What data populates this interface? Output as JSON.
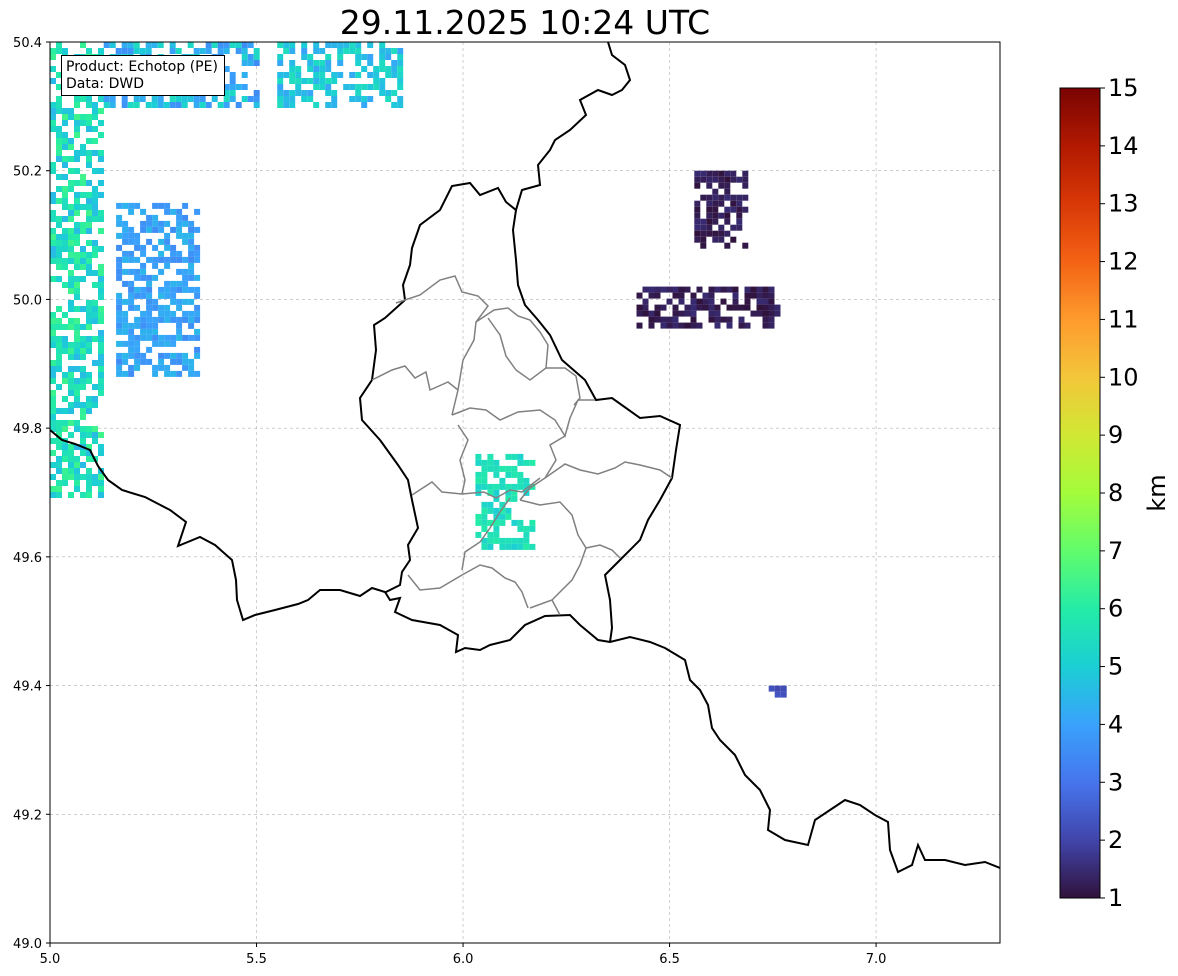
{
  "title": "29.11.2025 10:24 UTC",
  "info": {
    "product": "Product: Echotop (PE)",
    "data": "Data: DWD"
  },
  "chart_data": {
    "type": "heatmap",
    "title": "29.11.2025 10:24 UTC",
    "xlim": [
      5.0,
      7.3
    ],
    "ylim": [
      49.0,
      50.4
    ],
    "x_ticks": [
      5.0,
      5.5,
      6.0,
      6.5,
      7.0
    ],
    "x_tick_labels": [
      "5.0",
      "5.5",
      "6.0",
      "6.5",
      "7.0"
    ],
    "y_ticks": [
      49.0,
      49.2,
      49.4,
      49.6,
      49.8,
      50.0,
      50.2,
      50.4
    ],
    "y_tick_labels": [
      "49.0",
      "49.2",
      "49.4",
      "49.6",
      "49.8",
      "50.0",
      "50.2",
      "50.4"
    ],
    "grid": true,
    "colorbar": {
      "label": "km",
      "min": 1,
      "max": 15,
      "ticks": [
        1,
        2,
        3,
        4,
        5,
        6,
        7,
        8,
        9,
        10,
        11,
        12,
        13,
        14,
        15
      ],
      "colormap": "turbo",
      "stops": [
        "#30123b",
        "#4145ab",
        "#4675ed",
        "#39a2fc",
        "#1bcfd4",
        "#24eca6",
        "#61fc6c",
        "#a4fc3b",
        "#d1e834",
        "#f3c63a",
        "#fe9b2d",
        "#f36315",
        "#d93806",
        "#b11901",
        "#7a0403"
      ]
    },
    "echo_areas": [
      {
        "region": "western edge",
        "lon": [
          5.0,
          5.13
        ],
        "lat": [
          49.7,
          50.4
        ],
        "echotop_km": [
          4.5,
          6.5
        ]
      },
      {
        "region": "north-west",
        "lon": [
          5.13,
          5.5
        ],
        "lat": [
          50.3,
          50.4
        ],
        "echotop_km": [
          3.5,
          5.5
        ]
      },
      {
        "region": "west cluster",
        "lon": [
          5.16,
          5.36
        ],
        "lat": [
          49.88,
          50.15
        ],
        "echotop_km": [
          3.5,
          4.5
        ]
      },
      {
        "region": "northern cells",
        "lon": [
          5.55,
          5.85
        ],
        "lat": [
          50.3,
          50.4
        ],
        "echotop_km": [
          4.0,
          5.5
        ]
      },
      {
        "region": "central Luxembourg",
        "lon": [
          6.03,
          6.17
        ],
        "lat": [
          49.62,
          49.76
        ],
        "echotop_km": [
          5.0,
          6.0
        ]
      },
      {
        "region": "east cluster",
        "lon": [
          6.56,
          6.69
        ],
        "lat": [
          50.08,
          50.2
        ],
        "echotop_km": [
          1.0,
          1.5
        ]
      },
      {
        "region": "east band",
        "lon": [
          6.42,
          6.76
        ],
        "lat": [
          49.96,
          50.02
        ],
        "echotop_km": [
          1.0,
          1.5
        ]
      },
      {
        "region": "south-east",
        "lon": [
          6.74,
          6.77
        ],
        "lat": [
          49.39,
          49.4
        ],
        "echotop_km": [
          2.0,
          2.5
        ]
      }
    ]
  }
}
